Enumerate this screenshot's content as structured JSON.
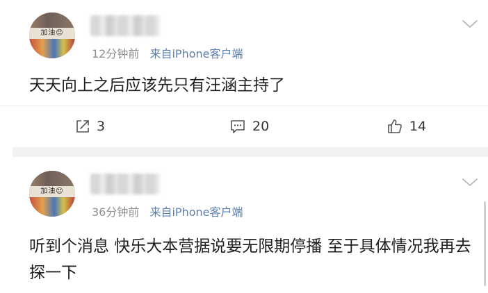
{
  "posts": [
    {
      "avatar_text": "加油😊",
      "time": "12分钟前",
      "source": "来自iPhone客户端",
      "content": "天天向上之后应该先只有汪涵主持了",
      "actions": {
        "repost_count": "3",
        "comment_count": "20",
        "like_count": "14"
      }
    },
    {
      "avatar_text": "加油😊",
      "time": "36分钟前",
      "source": "来自iPhone客户端",
      "content": "听到个消息 快乐大本营据说要无限期停播 至于具体情况我再去探一下"
    }
  ],
  "icons": {
    "more": "chevron-down-icon",
    "repost": "repost-icon",
    "comment": "comment-icon",
    "like": "thumbs-up-icon"
  },
  "colors": {
    "meta_text": "#8f8f8f",
    "source_text": "#5b7fb0",
    "content_text": "#1f1f1f",
    "divider": "#f2f2f2"
  }
}
